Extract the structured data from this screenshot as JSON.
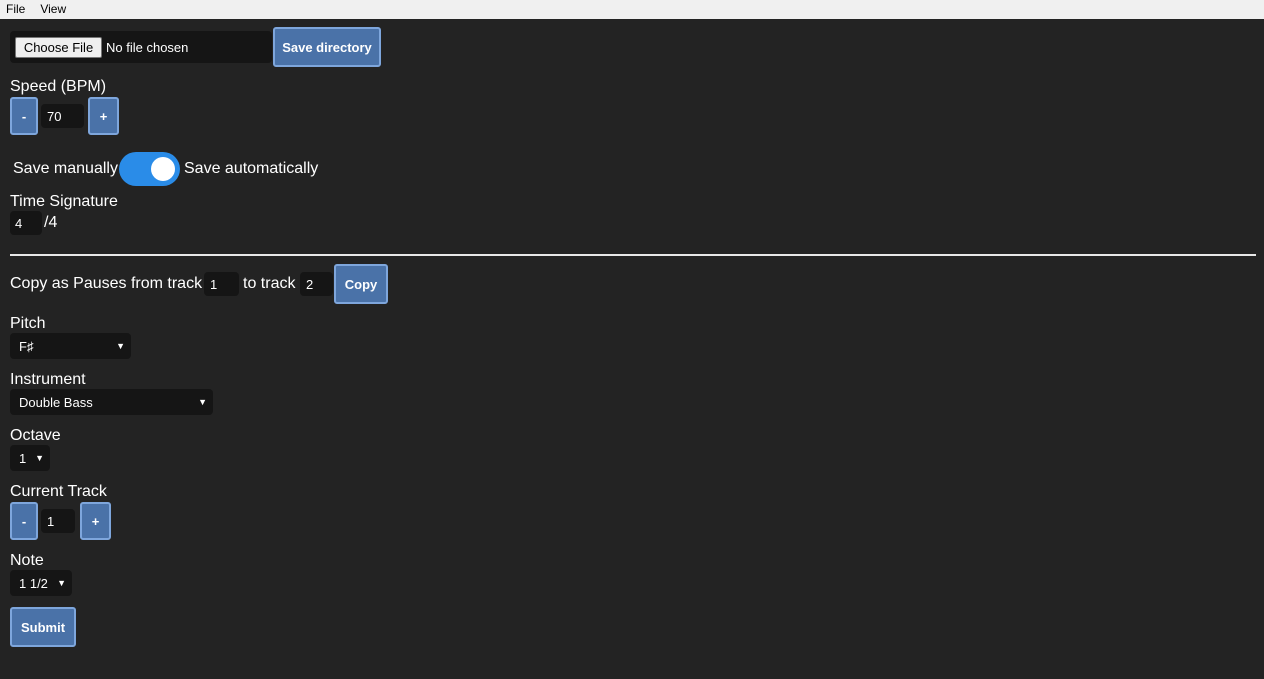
{
  "menu": {
    "items": [
      "File",
      "View"
    ]
  },
  "file": {
    "choose_label": "Choose File",
    "status": "No file chosen"
  },
  "save_directory_label": "Save directory",
  "speed": {
    "label": "Speed (BPM)",
    "minus": "-",
    "value": "70",
    "plus": "+"
  },
  "save_toggle": {
    "left_label": "Save manually",
    "right_label": "Save automatically",
    "state": "automatic"
  },
  "time_signature": {
    "label": "Time Signature",
    "numerator": "4",
    "denominator": "/4"
  },
  "copy": {
    "text1": "Copy as Pauses from track",
    "from_value": "1",
    "text2": "to track",
    "to_value": "2",
    "button": "Copy"
  },
  "pitch": {
    "label": "Pitch",
    "value": "F♯"
  },
  "instrument": {
    "label": "Instrument",
    "value": "Double Bass"
  },
  "octave": {
    "label": "Octave",
    "value": "1"
  },
  "track": {
    "label": "Current Track",
    "minus": "-",
    "value": "1",
    "plus": "+"
  },
  "note": {
    "label": "Note",
    "value": "1 1/2"
  },
  "submit_label": "Submit",
  "colors": {
    "background": "#232323",
    "button": "#4a72a8",
    "button_border": "#7ea6dc",
    "toggle": "#2a8ce8",
    "field": "#151515"
  }
}
